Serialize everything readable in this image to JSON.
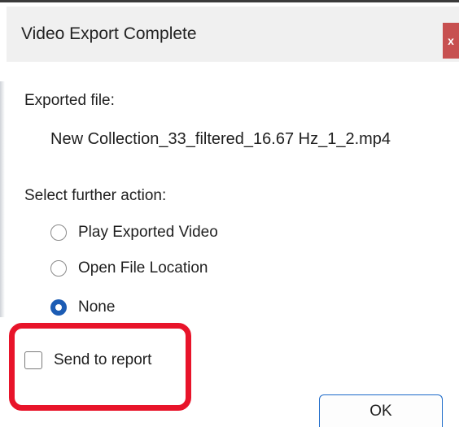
{
  "dialog": {
    "title": "Video Export Complete",
    "close_label": "x"
  },
  "exported": {
    "label": "Exported file:",
    "file_name": "New Collection_33_filtered_16.67 Hz_1_2.mp4"
  },
  "action": {
    "label": "Select further action:",
    "options": [
      {
        "label": "Play Exported Video",
        "selected": false
      },
      {
        "label": "Open File Location",
        "selected": false
      },
      {
        "label": "None",
        "selected": true
      }
    ]
  },
  "send_to_report": {
    "label": "Send to report",
    "checked": false
  },
  "buttons": {
    "ok_label": "OK"
  },
  "colors": {
    "accent": "#1c5cb4",
    "highlight": "#e8142a",
    "close": "#c75050"
  }
}
